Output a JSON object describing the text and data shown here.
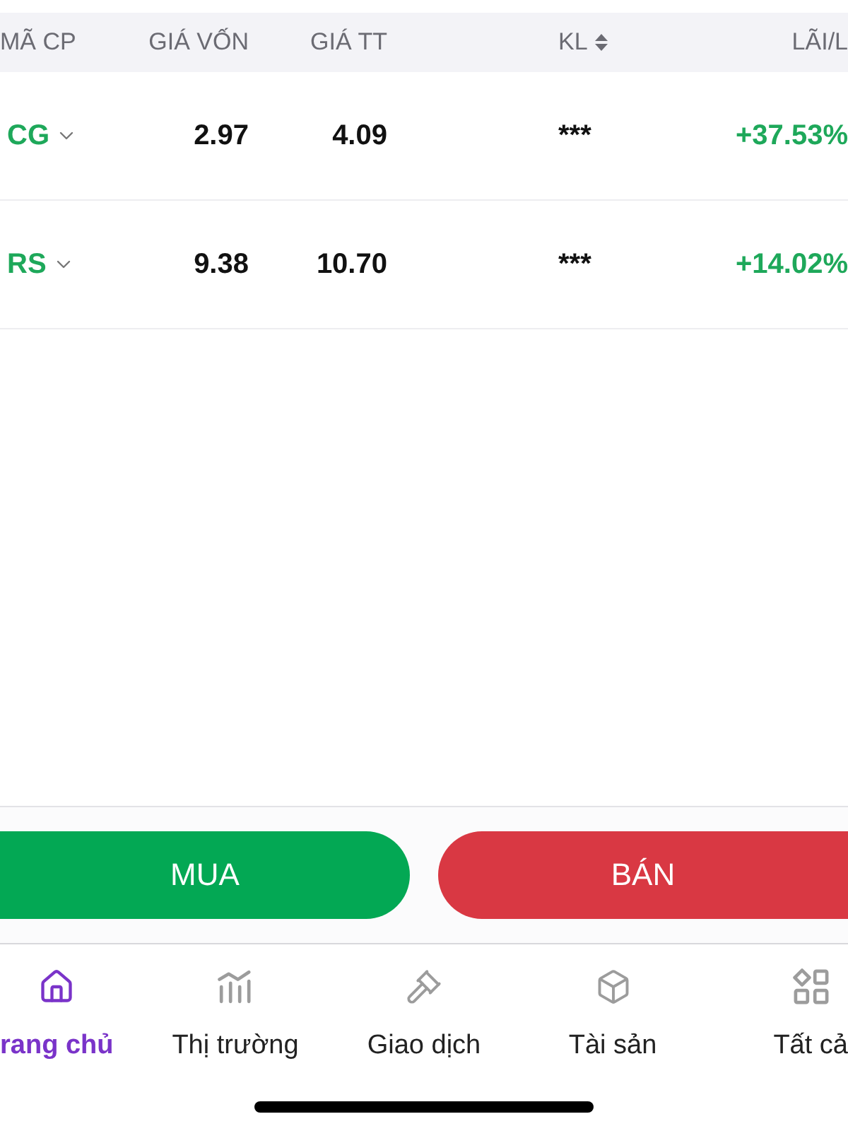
{
  "table": {
    "columns": [
      {
        "label": "MÃ CP",
        "sortable": false
      },
      {
        "label": "GIÁ VỐN",
        "sortable": false
      },
      {
        "label": "GIÁ TT",
        "sortable": false
      },
      {
        "label": "KL",
        "sortable": true
      },
      {
        "label": "LÃI/L",
        "sortable": false
      }
    ],
    "rows": [
      {
        "symbol": "CG",
        "cost_price": "2.97",
        "market_price": "4.09",
        "volume": "***",
        "profit_loss": "+37.53%"
      },
      {
        "symbol": "RS",
        "cost_price": "9.38",
        "market_price": "10.70",
        "volume": "***",
        "profit_loss": "+14.02%"
      }
    ]
  },
  "actions": [
    {
      "label": "MUA",
      "kind": "buy"
    },
    {
      "label": "BÁN",
      "kind": "sell"
    }
  ],
  "tab_bar": [
    {
      "label": "rang chủ",
      "selected": true
    },
    {
      "label": "Thị trường",
      "selected": false
    },
    {
      "label": "Giao dịch",
      "selected": false
    },
    {
      "label": "Tài sản",
      "selected": false
    },
    {
      "label": "Tất cả",
      "selected": false
    }
  ]
}
